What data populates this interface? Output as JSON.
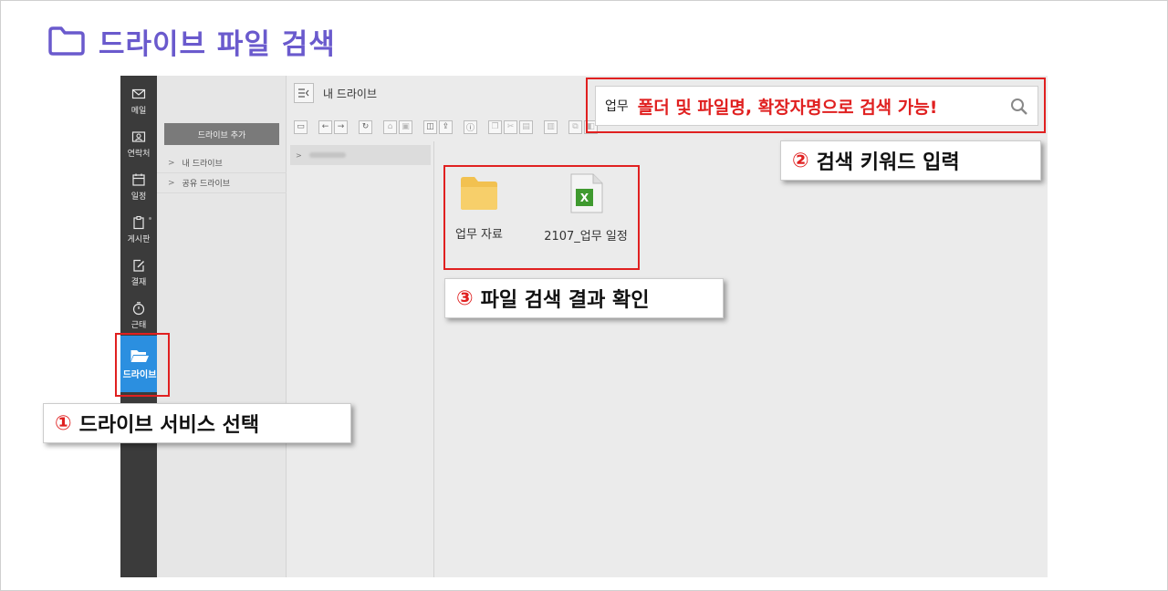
{
  "page": {
    "title": "드라이브 파일 검색",
    "title_color": "#6a5acd"
  },
  "nav": {
    "items": [
      {
        "label": "메일",
        "icon": "mail-icon"
      },
      {
        "label": "연락처",
        "icon": "contact-card-icon"
      },
      {
        "label": "일정",
        "icon": "calendar-icon"
      },
      {
        "label": "게시판",
        "icon": "clipboard-icon"
      },
      {
        "label": "결재",
        "icon": "pen-document-icon"
      },
      {
        "label": "근태",
        "icon": "stopwatch-icon"
      },
      {
        "label": "드라이브",
        "icon": "open-folder-icon",
        "active": true
      }
    ],
    "active_color": "#2b8fe0"
  },
  "panel": {
    "add_button": "드라이브 추가",
    "tree": [
      "내 드라이브",
      "공유 드라이브"
    ]
  },
  "header": {
    "title": "내 드라이브"
  },
  "search": {
    "query": "업무",
    "hint": "폴더 및 파일명, 확장자명으로 검색 가능!"
  },
  "files": [
    {
      "name": "업무 자료",
      "type": "folder"
    },
    {
      "name": "2107_업무 일정",
      "type": "excel",
      "badge": "X"
    }
  ],
  "callouts": [
    {
      "num": "①",
      "text": "드라이브 서비스 선택"
    },
    {
      "num": "②",
      "text": "검색 키워드 입력"
    },
    {
      "num": "③",
      "text": "파일 검색 결과 확인"
    }
  ],
  "colors": {
    "highlight": "#e02020",
    "rail_bg": "#3b3b3b",
    "folder": "#f7cf6a",
    "excel": "#3f9a2f"
  }
}
